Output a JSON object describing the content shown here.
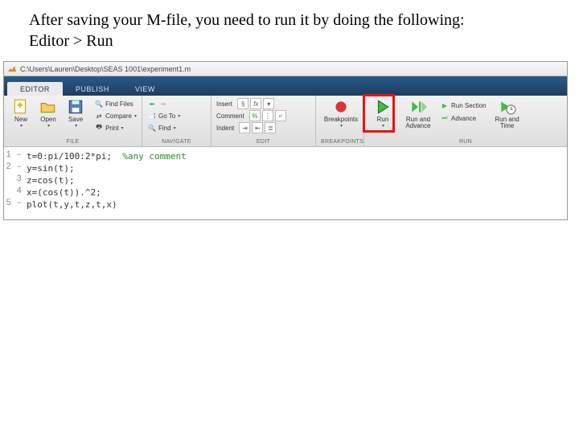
{
  "instruction": {
    "line1": "After saving your M-file, you need to run it by doing the following:",
    "line2": "Editor > Run"
  },
  "titlebar": {
    "path": "C:\\Users\\Lauren\\Desktop\\SEAS 1001\\experiment1.m"
  },
  "tabs": {
    "editor": "EDITOR",
    "publish": "PUBLISH",
    "view": "VIEW"
  },
  "file_group": {
    "new": "New",
    "open": "Open",
    "save": "Save",
    "find_files": "Find Files",
    "compare": "Compare",
    "print": "Print",
    "label": "FILE"
  },
  "nav_group": {
    "goto": "Go To",
    "find": "Find",
    "label": "NAVIGATE"
  },
  "edit_group": {
    "insert": "Insert",
    "comment": "Comment",
    "indent": "Indent",
    "label": "EDIT"
  },
  "bp_group": {
    "breakpoints": "Breakpoints",
    "label": "BREAKPOINTS"
  },
  "run_group": {
    "run": "Run",
    "run_advance": "Run and\nAdvance",
    "run_section": "Run Section",
    "advance": "Advance",
    "run_time": "Run and\nTime",
    "label": "RUN"
  },
  "code": {
    "gutter": [
      "1 –",
      "2 –",
      "3",
      "4",
      "5 –"
    ],
    "lines": [
      {
        "text": "t=0:pi/100:2*pi;  ",
        "comment": "%any comment"
      },
      {
        "text": "y=sin(t);"
      },
      {
        "text": "z=cos(t);"
      },
      {
        "text": "x=(cos(t)).^2;"
      },
      {
        "text": "plot(t,y,t,z,t,x)"
      }
    ]
  }
}
